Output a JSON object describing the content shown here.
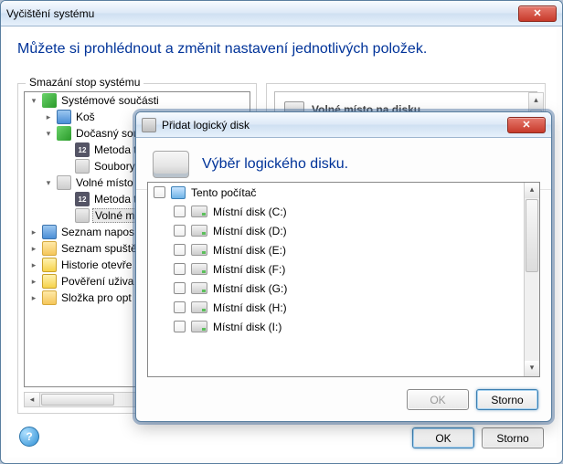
{
  "main": {
    "title": "Vyčištění systému",
    "headline": "Můžete si prohlédnout a změnit nastavení jednotlivých položek.",
    "group_label": "Smazání stop systému",
    "right_panel_title": "Volné místo na disku",
    "tree": {
      "n0": "Systémové součásti",
      "n0_0": "Koš",
      "n0_1": "Dočasný soub",
      "n0_1_0": "Metoda trv",
      "n0_1_1": "Soubory",
      "n0_2": "Volné místo n",
      "n0_2_0": "Metoda trv",
      "n0_2_1": "Volné míst",
      "n1": "Seznam napos",
      "n2": "Seznam spuště",
      "n3": "Historie otevře",
      "n4": "Pověření uživa",
      "n5": "Složka pro opt"
    },
    "ok_label": "OK",
    "cancel_label": "Storno"
  },
  "dialog": {
    "title": "Přidat logický disk",
    "headline": "Výběr logického disku.",
    "root_label": "Tento počítač",
    "disks": {
      "d0": "Místní disk (C:)",
      "d1": "Místní disk (D:)",
      "d2": "Místní disk (E:)",
      "d3": "Místní disk (F:)",
      "d4": "Místní disk (G:)",
      "d5": "Místní disk (H:)",
      "d6": "Místní disk (I:)"
    },
    "ok_label": "OK",
    "cancel_label": "Storno"
  }
}
